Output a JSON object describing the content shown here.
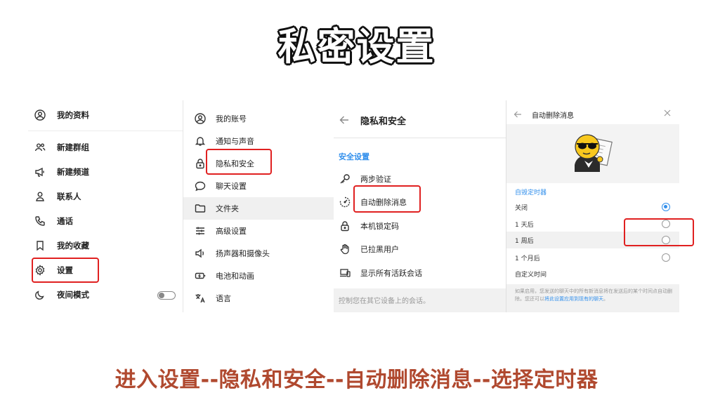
{
  "title": "私密设置",
  "caption": "进入设置--隐私和安全--自动删除消息--选择定时器",
  "panel1": {
    "items": [
      {
        "label": "我的资料",
        "icon": "person-circle-icon"
      },
      {
        "label": "新建群组",
        "icon": "group-icon"
      },
      {
        "label": "新建频道",
        "icon": "megaphone-icon"
      },
      {
        "label": "联系人",
        "icon": "person-icon"
      },
      {
        "label": "通话",
        "icon": "phone-icon"
      },
      {
        "label": "我的收藏",
        "icon": "bookmark-icon"
      },
      {
        "label": "设置",
        "icon": "gear-icon"
      },
      {
        "label": "夜间模式",
        "icon": "moon-icon",
        "toggle": false
      }
    ]
  },
  "panel2": {
    "items": [
      {
        "label": "我的账号",
        "icon": "account-icon"
      },
      {
        "label": "通知与声音",
        "icon": "bell-icon"
      },
      {
        "label": "隐私和安全",
        "icon": "lock-icon"
      },
      {
        "label": "聊天设置",
        "icon": "chat-bubble-icon"
      },
      {
        "label": "文件夹",
        "icon": "folder-icon"
      },
      {
        "label": "高级设置",
        "icon": "sliders-icon"
      },
      {
        "label": "扬声器和摄像头",
        "icon": "speaker-icon"
      },
      {
        "label": "电池和动画",
        "icon": "battery-icon"
      },
      {
        "label": "语言",
        "icon": "translate-icon"
      }
    ]
  },
  "panel3": {
    "title": "隐私和安全",
    "section": "安全设置",
    "items": [
      {
        "label": "两步验证",
        "icon": "key-icon"
      },
      {
        "label": "自动删除消息",
        "icon": "timer-icon"
      },
      {
        "label": "本机锁定码",
        "icon": "padlock-icon"
      },
      {
        "label": "已拉黑用户",
        "icon": "hand-icon"
      },
      {
        "label": "显示所有活跃会话",
        "icon": "devices-icon"
      }
    ],
    "footer": "控制您在其它设备上的会话。"
  },
  "panel4": {
    "title": "自动删除消息",
    "section": "自毁定时器",
    "options": [
      {
        "label": "关闭",
        "selected": true
      },
      {
        "label": "1 天后",
        "selected": false
      },
      {
        "label": "1 周后",
        "selected": false
      },
      {
        "label": "1 个月后",
        "selected": false
      }
    ],
    "custom": "自定义时间",
    "footer_text": "如果启用，您发送的聊天中的所有新消息将在发送后的某个时间点自动删除。您还可以",
    "footer_link": "将此设置应用到现有的聊天",
    "footer_end": "。"
  },
  "colors": {
    "accent": "#3390ec",
    "highlight": "#e02020",
    "caption": "#b0492f"
  }
}
